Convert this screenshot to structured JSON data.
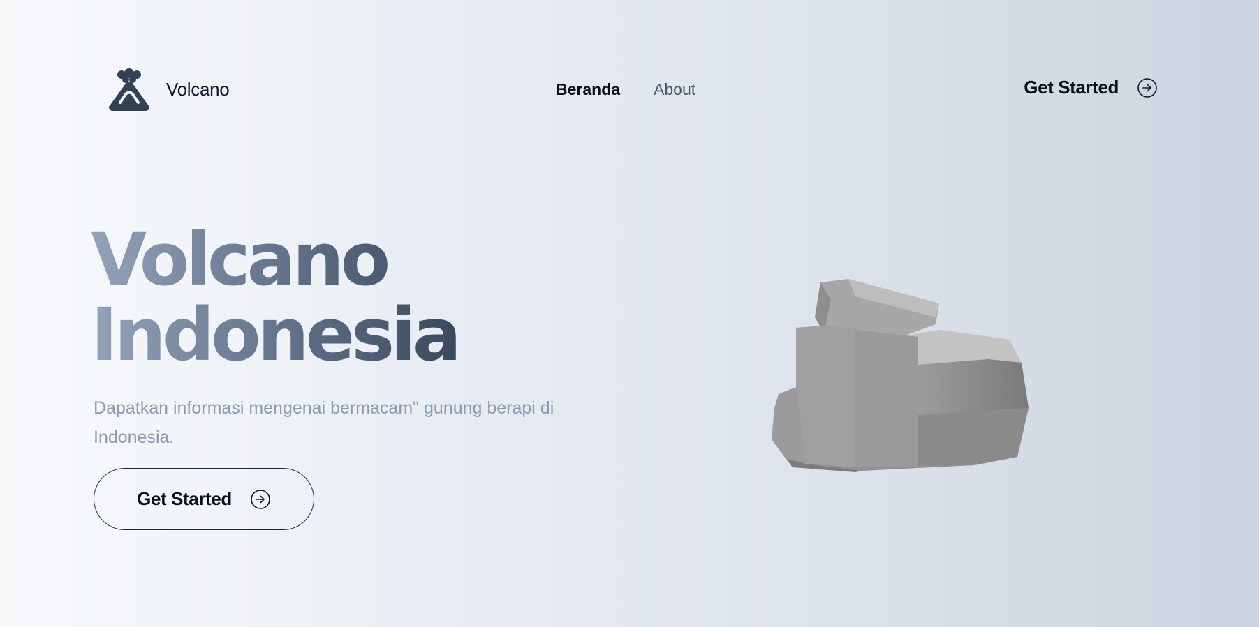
{
  "header": {
    "brand_name": "Volcano",
    "logo_icon": "volcano-icon",
    "nav": [
      {
        "label": "Beranda",
        "active": true
      },
      {
        "label": "About",
        "active": false
      }
    ],
    "cta_label": "Get Started",
    "cta_icon": "arrow-right-circle-icon"
  },
  "hero": {
    "title_line1": "Volcano",
    "title_line2": "Indonesia",
    "subtitle": "Dapatkan informasi mengenai bermacam\" gunung berapi di Indonesia.",
    "cta_label": "Get Started",
    "cta_icon": "arrow-right-circle-icon",
    "image": "rock-3d-illustration"
  },
  "colors": {
    "text_dark": "#0f172a",
    "subtitle": "#8a9bb4",
    "logo": "#334155",
    "title_gradient_start": "#94a3b8",
    "title_gradient_end": "#334155"
  }
}
